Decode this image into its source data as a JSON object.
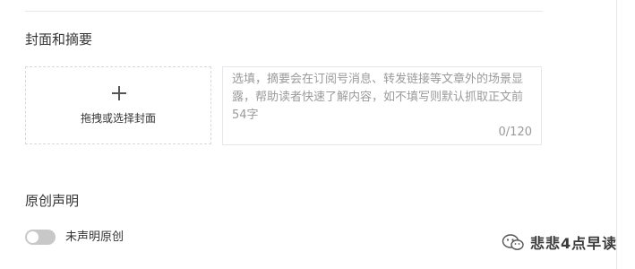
{
  "cover_section": {
    "title": "封面和摘要",
    "cover_upload_label": "拖拽或选择封面"
  },
  "summary": {
    "placeholder": "选填，摘要会在订阅号消息、转发链接等文章外的场景显露，帮助读者快速了解内容，如不填写则默认抓取正文前54字",
    "counter": "0/120"
  },
  "original_section": {
    "title": "原创声明",
    "toggle_label": "未声明原创",
    "toggle_on": false
  },
  "watermark": {
    "icon": "wechat-icon",
    "text": "悲悲4点早读"
  },
  "colors": {
    "border": "#e7e7eb",
    "placeholder": "#9a9a9a",
    "toggle_off": "#c8c8c8"
  }
}
